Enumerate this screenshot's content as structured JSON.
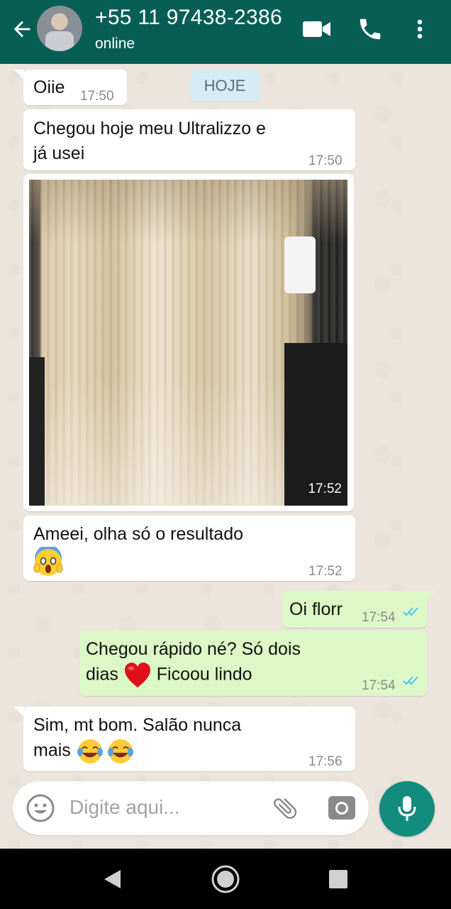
{
  "header": {
    "contact_name": "+55 11 97438-2386",
    "status": "online",
    "bg_color": "#075e54"
  },
  "date_chip": "HOJE",
  "messages": [
    {
      "dir": "in",
      "text": "Oiie",
      "time": "17:50"
    },
    {
      "dir": "in",
      "text_lines": [
        "Chegou hoje meu Ultralizzo e",
        "já usei"
      ],
      "time": "17:50"
    },
    {
      "dir": "in",
      "type": "image",
      "image_desc": "long straight blonde hair photo",
      "time": "17:52"
    },
    {
      "dir": "in",
      "text_lines": [
        "Ameei, olha só o resultado"
      ],
      "emoji": "scream-face-emoji",
      "time": "17:52"
    },
    {
      "dir": "out",
      "text": "Oi florr",
      "time": "17:54",
      "status": "read"
    },
    {
      "dir": "out",
      "text_lines": [
        "Chegou rápido né? Só dois",
        "dias",
        "Ficoou lindo"
      ],
      "emoji": "red-heart-emoji",
      "time": "17:54",
      "status": "read"
    },
    {
      "dir": "in",
      "text_lines": [
        "Sim, mt bom. Salão nunca",
        "mais"
      ],
      "emoji": "tears-of-joy-emoji",
      "time": "17:56"
    }
  ],
  "composer": {
    "placeholder": "Digite aqui..."
  },
  "colors": {
    "out_bubble": "#dcf8c6",
    "in_bubble": "#ffffff",
    "accent": "#128c7e",
    "read_ticks": "#4fc3f7"
  }
}
